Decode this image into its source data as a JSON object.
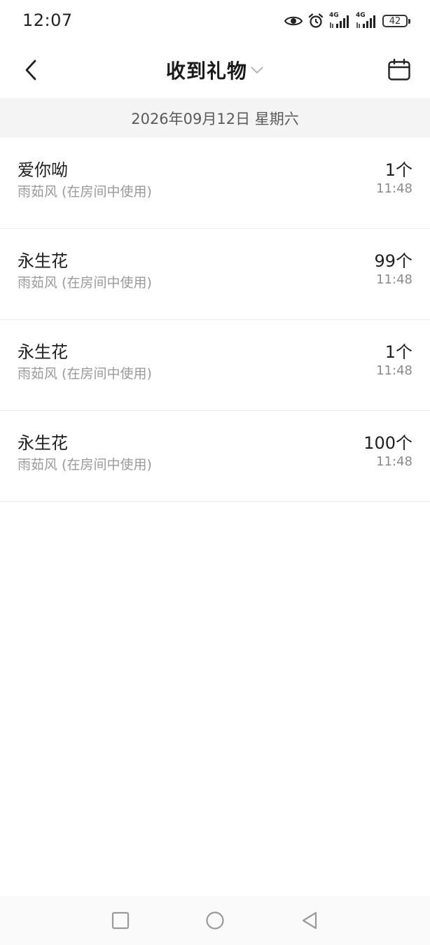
{
  "status_bar": {
    "time": "12:07",
    "network_1": "4G",
    "network_2": "4G",
    "battery": "42"
  },
  "header": {
    "title": "收到礼物"
  },
  "date_header": "2026年09月12日 星期六",
  "gifts": [
    {
      "name": "爱你呦",
      "source": "雨茹风 (在房间中使用)",
      "count": "1个",
      "time": "11:48"
    },
    {
      "name": "永生花",
      "source": "雨茹风 (在房间中使用)",
      "count": "99个",
      "time": "11:48"
    },
    {
      "name": "永生花",
      "source": "雨茹风 (在房间中使用)",
      "count": "1个",
      "time": "11:48"
    },
    {
      "name": "永生花",
      "source": "雨茹风 (在房间中使用)",
      "count": "100个",
      "time": "11:48"
    }
  ],
  "icons": {
    "back": "chevron-left-icon",
    "title_dropdown": "chevron-down-icon",
    "calendar": "calendar-icon",
    "eye": "eye-icon",
    "alarm": "alarm-clock-icon",
    "signal": "signal-bars-icon",
    "nav_recents": "square-icon",
    "nav_home": "circle-icon",
    "nav_back": "triangle-back-icon"
  },
  "colors": {
    "date_strip_bg": "#f4f4f4",
    "secondary_text": "#9a9a9a",
    "divider": "#ececec"
  }
}
